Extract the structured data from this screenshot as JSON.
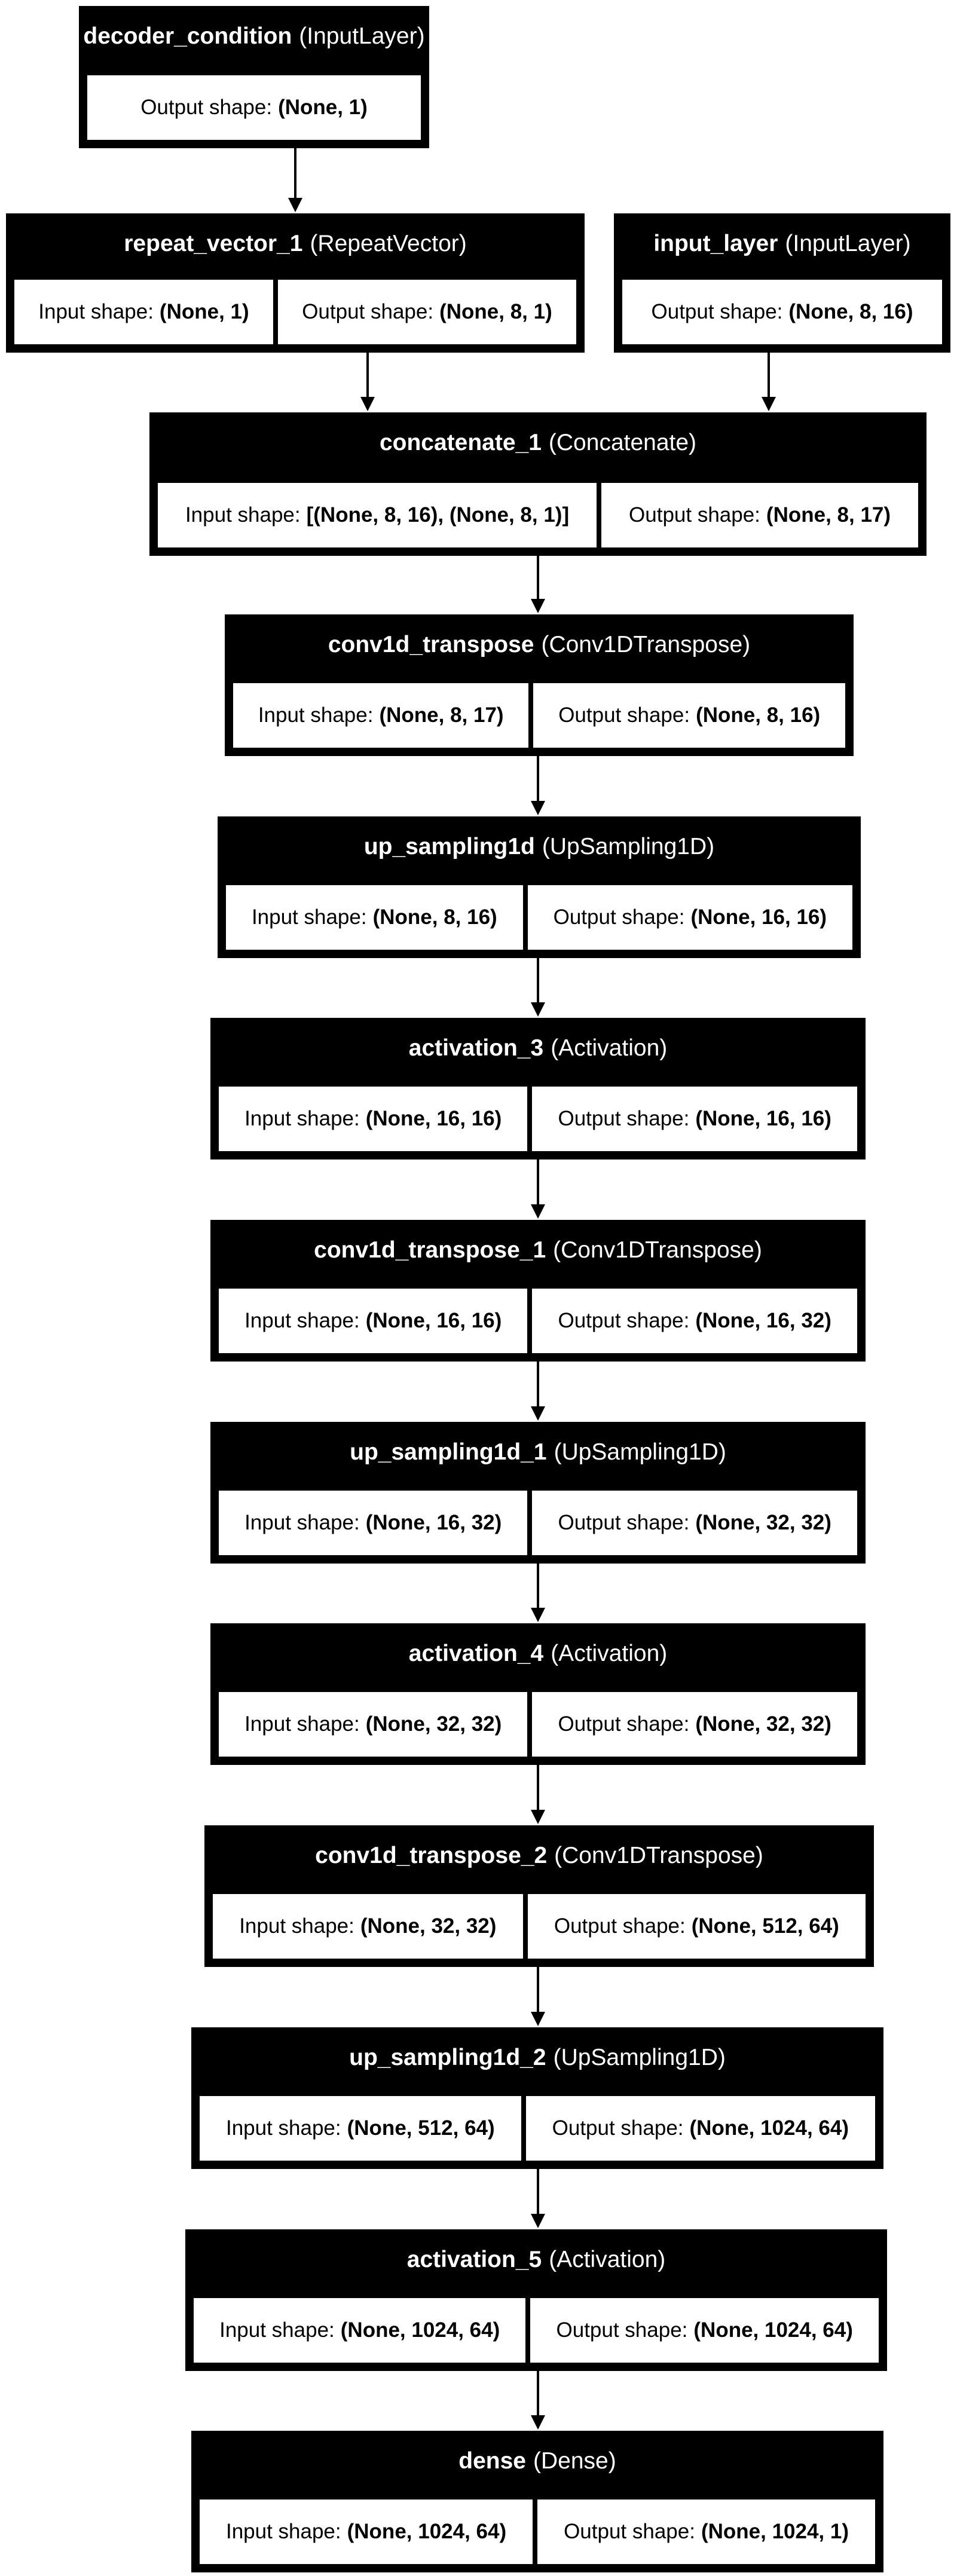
{
  "labels": {
    "input": "Input shape:",
    "output": "Output shape:"
  },
  "nodes": [
    {
      "name": "decoder_condition",
      "type": "(InputLayer)",
      "output": "(None, 1)"
    },
    {
      "name": "repeat_vector_1",
      "type": "(RepeatVector)",
      "input": "(None, 1)",
      "output": "(None, 8, 1)"
    },
    {
      "name": "input_layer",
      "type": "(InputLayer)",
      "output": "(None, 8, 16)"
    },
    {
      "name": "concatenate_1",
      "type": "(Concatenate)",
      "input": "[(None, 8, 16), (None, 8, 1)]",
      "output": "(None, 8, 17)"
    },
    {
      "name": "conv1d_transpose",
      "type": "(Conv1DTranspose)",
      "input": "(None, 8, 17)",
      "output": "(None, 8, 16)"
    },
    {
      "name": "up_sampling1d",
      "type": "(UpSampling1D)",
      "input": "(None, 8, 16)",
      "output": "(None, 16, 16)"
    },
    {
      "name": "activation_3",
      "type": "(Activation)",
      "input": "(None, 16, 16)",
      "output": "(None, 16, 16)"
    },
    {
      "name": "conv1d_transpose_1",
      "type": "(Conv1DTranspose)",
      "input": "(None, 16, 16)",
      "output": "(None, 16, 32)"
    },
    {
      "name": "up_sampling1d_1",
      "type": "(UpSampling1D)",
      "input": "(None, 16, 32)",
      "output": "(None, 32, 32)"
    },
    {
      "name": "activation_4",
      "type": "(Activation)",
      "input": "(None, 32, 32)",
      "output": "(None, 32, 32)"
    },
    {
      "name": "conv1d_transpose_2",
      "type": "(Conv1DTranspose)",
      "input": "(None, 32, 32)",
      "output": "(None, 512, 64)"
    },
    {
      "name": "up_sampling1d_2",
      "type": "(UpSampling1D)",
      "input": "(None, 512, 64)",
      "output": "(None, 1024, 64)"
    },
    {
      "name": "activation_5",
      "type": "(Activation)",
      "input": "(None, 1024, 64)",
      "output": "(None, 1024, 64)"
    },
    {
      "name": "dense",
      "type": "(Dense)",
      "input": "(None, 1024, 64)",
      "output": "(None, 1024, 1)"
    }
  ],
  "edges": [
    [
      "decoder_condition",
      "repeat_vector_1"
    ],
    [
      "repeat_vector_1",
      "concatenate_1"
    ],
    [
      "input_layer",
      "concatenate_1"
    ],
    [
      "concatenate_1",
      "conv1d_transpose"
    ],
    [
      "conv1d_transpose",
      "up_sampling1d"
    ],
    [
      "up_sampling1d",
      "activation_3"
    ],
    [
      "activation_3",
      "conv1d_transpose_1"
    ],
    [
      "conv1d_transpose_1",
      "up_sampling1d_1"
    ],
    [
      "up_sampling1d_1",
      "activation_4"
    ],
    [
      "activation_4",
      "conv1d_transpose_2"
    ],
    [
      "conv1d_transpose_2",
      "up_sampling1d_2"
    ],
    [
      "up_sampling1d_2",
      "activation_5"
    ],
    [
      "activation_5",
      "dense"
    ]
  ]
}
